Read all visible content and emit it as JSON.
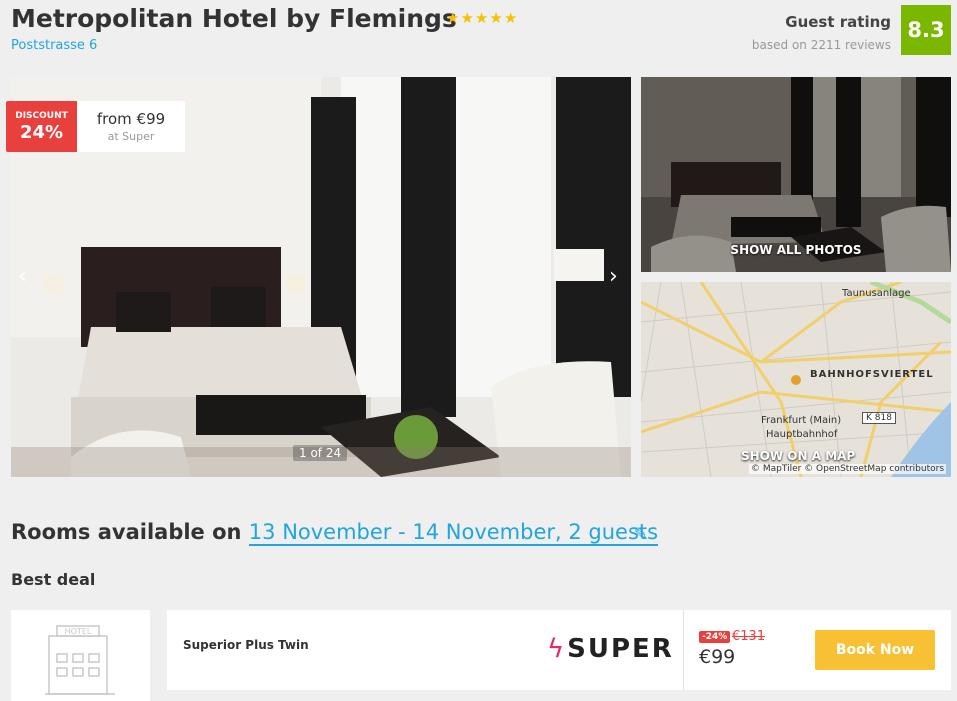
{
  "hotel": {
    "name": "Metropolitan Hotel by Flemings",
    "stars": 5,
    "address": "Poststrasse 6"
  },
  "rating": {
    "label": "Guest rating",
    "reviews": "based on 2211 reviews",
    "score": "8.3",
    "color": "#7ab800"
  },
  "gallery": {
    "discount_label": "DISCOUNT",
    "discount_pct": "24%",
    "from_price": "from €99",
    "from_provider": "at Super",
    "counter": "1 of 24",
    "show_all": "SHOW ALL PHOTOS"
  },
  "map": {
    "show_on_map": "SHOW ON A MAP",
    "credit": "© MapTiler © OpenStreetMap contributors",
    "labels": {
      "taunusanlage": "Taunusanlage",
      "district": "BAHNHOFSVIERTEL",
      "station_1": "Frankfurt (Main)",
      "station_2": "Hauptbahnhof",
      "road": "K 818"
    }
  },
  "rooms": {
    "prefix": "Rooms available on",
    "dates": "13 November - 14 November, 2 guests",
    "best_deal": "Best deal"
  },
  "deal": {
    "room_name": "Superior Plus Twin",
    "provider": "SUPER",
    "discount": "-24%",
    "old_price": "€131",
    "new_price": "€99",
    "book_label": "Book Now"
  },
  "hotel_placeholder_sign": "HOTEL",
  "colors": {
    "accent": "#1ea6dd",
    "discount": "#e8413d",
    "button": "#f8c033",
    "super_brand": "#e8266b"
  }
}
